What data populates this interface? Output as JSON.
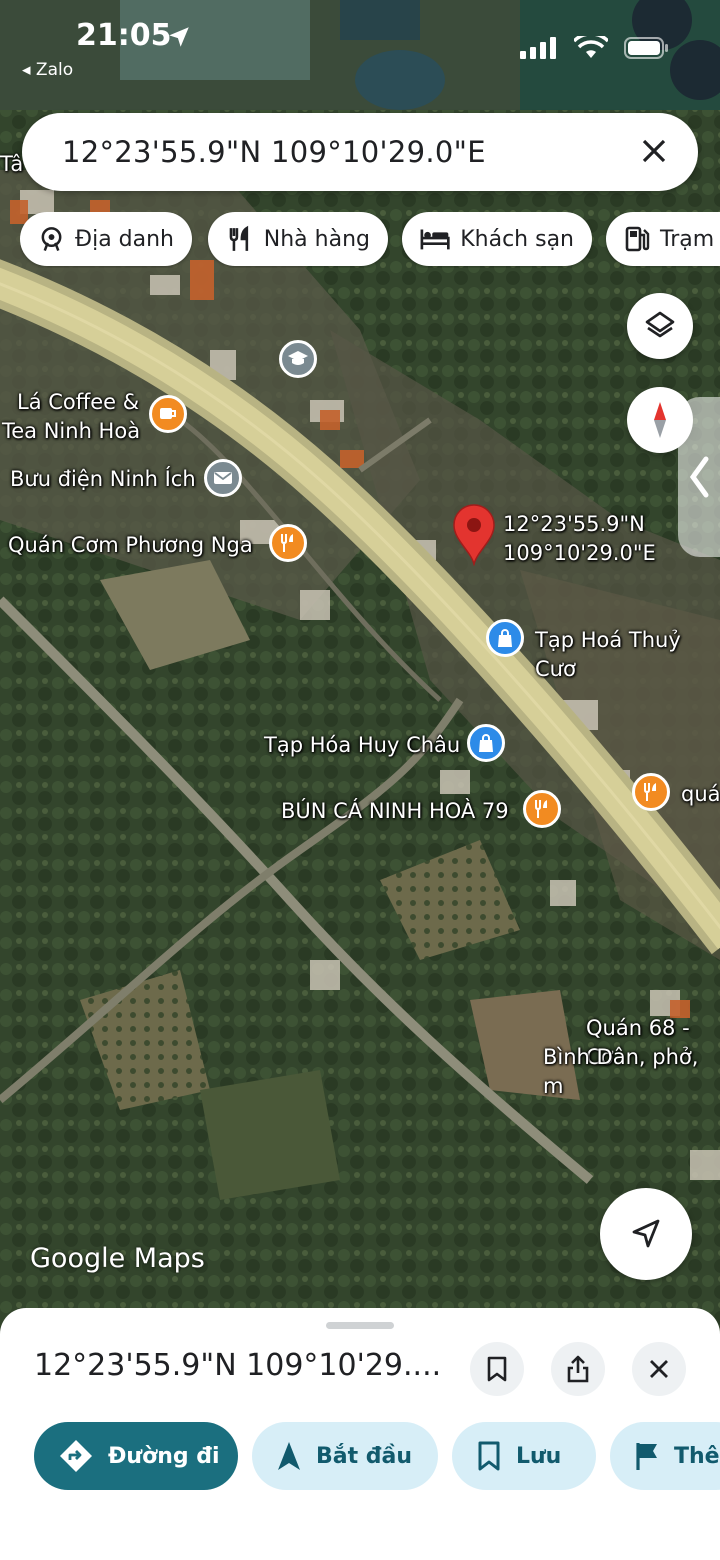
{
  "status": {
    "time": "21:05",
    "back_label": "◂ Zalo"
  },
  "search": {
    "query": "12°23'55.9\"N 109°10'29.0\"E"
  },
  "chips": [
    {
      "label": "Địa danh",
      "icon": "landmark-icon"
    },
    {
      "label": "Nhà hàng",
      "icon": "restaurant-icon"
    },
    {
      "label": "Khách sạn",
      "icon": "hotel-icon"
    },
    {
      "label": "Trạm",
      "icon": "gas-station-icon"
    }
  ],
  "map": {
    "pin_label_line1": "12°23'55.9\"N",
    "pin_label_line2": "109°10'29.0\"E",
    "places": {
      "la_coffee_1": "Lá Coffee &",
      "la_coffee_2": "Tea Ninh Hoà",
      "buu_dien": "Bưu điện Ninh Ích",
      "quan_com": "Quán Cơm Phương Nga",
      "tap_hoa_thuy": "Tạp Hoá Thuỷ Cươ",
      "tap_hoa_huy": "Tạp Hóa Huy Châu",
      "bun_ca": "BÚN CÁ NINH HOÀ 79",
      "quan_right": "quá",
      "quan68_1": "Quán 68 - Cơ",
      "quan68_2": "Bình Dân, phở, m",
      "edge_label": "Tâ"
    },
    "attribution": "Google Maps"
  },
  "sheet": {
    "title": "12°23'55.9\"N 109°10'29....",
    "actions": [
      {
        "label": "Đường đi",
        "icon": "directions-icon"
      },
      {
        "label": "Bắt đầu",
        "icon": "navigation-arrow-icon"
      },
      {
        "label": "Lưu",
        "icon": "bookmark-icon"
      },
      {
        "label": "Thê",
        "icon": "flag-icon"
      }
    ]
  },
  "colors": {
    "accent": "#1b6f7f",
    "chip_bg": "#d7eef7",
    "pin": "#e3342f",
    "food_poi": "#f28b21",
    "shop_poi": "#2d8be8"
  }
}
